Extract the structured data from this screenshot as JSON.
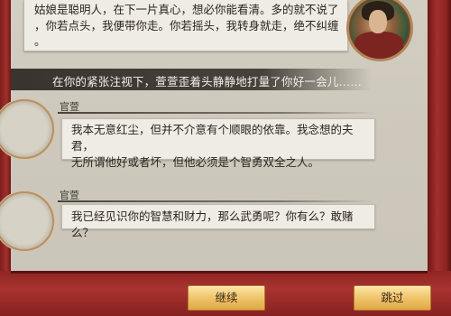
{
  "narration_top": "姑娘是聪明人，在下一片真心，想必你能看清。多的就不说了\n，你若点头，我便带你走。你若摇头，我转身就走，绝不纠缠\n。",
  "narration_banner": "在你的紧张注视下，萱萱歪着头静静地打量了你好一会儿……",
  "dialogues": [
    {
      "speaker": "官萱",
      "text": "我本无意红尘，但并不介意有个顺眼的依靠。我念想的夫君，\n无所谓他好或者坏，但他必须是个智勇双全之人。"
    },
    {
      "speaker": "官萱",
      "text": "我已经见识你的智慧和财力，那么武勇呢？你有么？敢赌么？"
    }
  ],
  "buttons": {
    "continue": "继续",
    "skip": "跳过"
  }
}
